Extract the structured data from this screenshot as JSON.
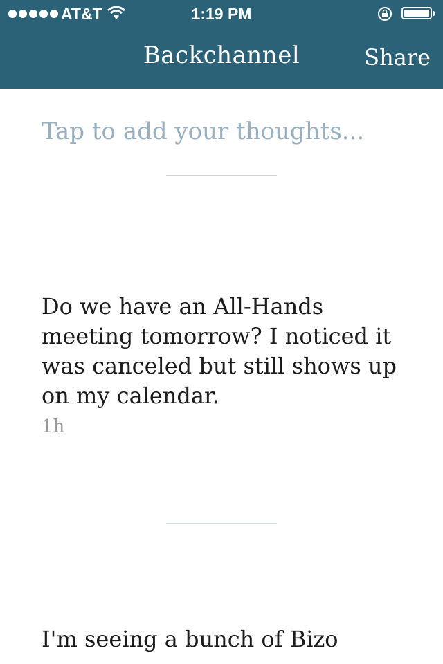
{
  "status_bar": {
    "carrier": "AT&T",
    "time": "1:19 PM",
    "signal_icon": "signal-dots-icon",
    "wifi_icon": "wifi-icon",
    "lock_icon": "rotation-lock-icon",
    "battery_icon": "battery-icon",
    "battery_level": 1.0
  },
  "nav": {
    "title": "Backchannel",
    "share_label": "Share"
  },
  "compose": {
    "placeholder": "Tap to add your thoughts..."
  },
  "posts": [
    {
      "text": "Do we have an All-Hands meeting tomorrow? I noticed it was canceled but still shows up on my calendar.",
      "time": "1h"
    },
    {
      "text": "I'm seeing a bunch of Bizo",
      "time": ""
    }
  ],
  "colors": {
    "header": "#2c6278",
    "placeholder": "#98b0bf",
    "divider": "#cfd8de",
    "text": "#1c1c1c",
    "timestamp": "#9a9a9a"
  }
}
